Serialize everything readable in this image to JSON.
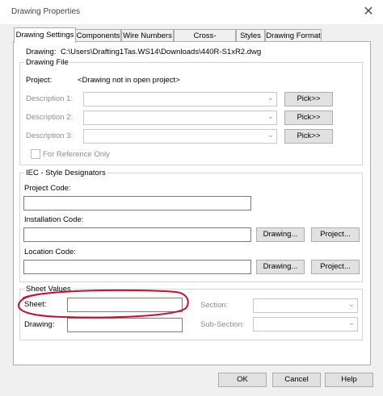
{
  "window": {
    "title": "Drawing Properties",
    "close_glyph": "✕"
  },
  "tabs": [
    {
      "label": "Drawing Settings"
    },
    {
      "label": "Components"
    },
    {
      "label": "Wire Numbers"
    },
    {
      "label": "Cross-References"
    },
    {
      "label": "Styles"
    },
    {
      "label": "Drawing Format"
    }
  ],
  "drawing": {
    "label": "Drawing:",
    "path": "C:\\Users\\Drafting1Tas.WS14\\Downloads\\440R-S1xR2.dwg"
  },
  "drawing_file": {
    "group_label": "Drawing File",
    "project_label": "Project:",
    "project_value": "<Drawing not in open project>",
    "descriptions": [
      {
        "label": "Description 1:",
        "pick": "Pick>>"
      },
      {
        "label": "Description 2:",
        "pick": "Pick>>"
      },
      {
        "label": "Description 3:",
        "pick": "Pick>>"
      }
    ],
    "reference_only_label": "For Reference Only"
  },
  "iec": {
    "group_label": "IEC - Style Designators",
    "project_code_label": "Project Code:",
    "installation_code_label": "Installation Code:",
    "location_code_label": "Location Code:",
    "drawing_btn": "Drawing...",
    "project_btn": "Project..."
  },
  "sheet_values": {
    "group_label": "Sheet Values",
    "sheet_label": "Sheet:",
    "drawing_label": "Drawing:",
    "section_label": "Section:",
    "subsection_label": "Sub-Section:"
  },
  "footer": {
    "ok": "OK",
    "cancel": "Cancel",
    "help": "Help"
  },
  "colors": {
    "annotation_circle": "#c8102e",
    "dialog_bg": "#f0f0f0",
    "panel_bg": "#ffffff"
  },
  "icons": {
    "dropdown": "chevron-down-icon",
    "close": "close-icon"
  }
}
